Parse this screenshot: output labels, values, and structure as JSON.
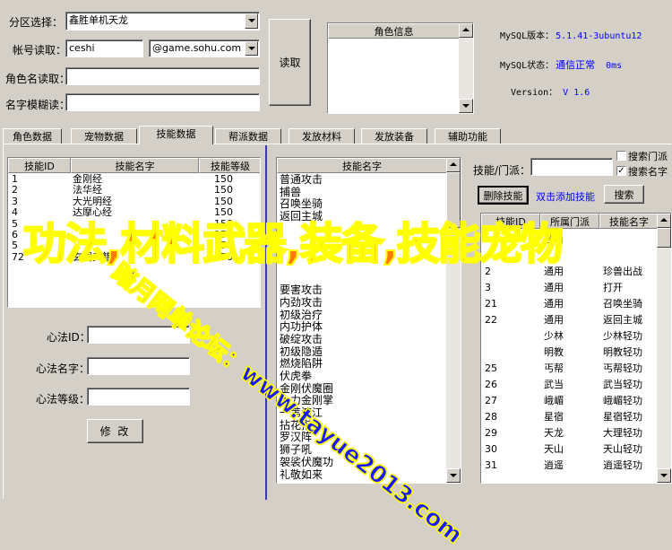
{
  "top": {
    "server_label": "分区选择：",
    "server_value": "鑫胜单机天龙",
    "account_label": "帐号读取：",
    "account_value": "ceshi",
    "domain_value": "@game.sohu.com",
    "role_read_label": "角色名读取：",
    "name_fuzzy_label": "名字模糊读：",
    "read_button": "读取",
    "role_info_header": "角色信息"
  },
  "mysql": {
    "version_label": "MySQL版本：",
    "version_value": "5.1.41-3ubuntu12",
    "status_label": "MySQL状态：",
    "status_value": "通信正常",
    "latency": "0ms",
    "app_version_label": "Version：",
    "app_version_value": "V 1.6"
  },
  "tabs": [
    "角色数据",
    "宠物数据",
    "技能数据",
    "帮派数据",
    "发放材料",
    "发放装备",
    "辅助功能"
  ],
  "active_tab": "技能数据",
  "skills_table": {
    "headers": [
      "技能ID",
      "技能名字",
      "技能等级"
    ],
    "rows": [
      {
        "id": "1",
        "name": "金刚经",
        "level": "150"
      },
      {
        "id": "2",
        "name": "法华经",
        "level": "150"
      },
      {
        "id": "3",
        "name": "大光明经",
        "level": "150"
      },
      {
        "id": "4",
        "name": "达摩心经",
        "level": "150"
      },
      {
        "id": "5",
        "name": "",
        "level": "150"
      },
      {
        "id": "6",
        "name": "",
        "level": "150"
      },
      {
        "id": "5",
        "name": "",
        "level": "150"
      },
      {
        "id": "72",
        "name": "玄同典籍",
        "level": "150"
      }
    ]
  },
  "xinfa": {
    "id_label": "心法ID：",
    "name_label": "心法名字：",
    "level_label": "心法等级：",
    "modify_button": "修 改"
  },
  "skill_names": {
    "header": "技能名字",
    "items": [
      "普通攻击",
      "捕兽",
      "召唤坐骑",
      "返回主城",
      "",
      "",
      "",
      "",
      "",
      "要害攻击",
      "内劲攻击",
      "初级治疗",
      "内功护体",
      "破绽攻击",
      "初级隐遁",
      "燃烧陷阱",
      "伏虎拳",
      "金刚伏魔圈",
      "大力金刚掌",
      "一苇渡江",
      "拈花指",
      "罗汉阵",
      "狮子吼",
      "袈裟伏魔功",
      "礼敬如来"
    ]
  },
  "right_panel": {
    "search_label": "技能/门派：",
    "search_value": "",
    "chk_sect_label": "搜索门派",
    "chk_sect_checked": false,
    "chk_name_label": "搜索名字",
    "chk_name_checked": true,
    "delete_button": "删除技能",
    "add_hint": "双击添加技能",
    "search_button": "搜索",
    "headers": [
      "技能ID",
      "所属门派",
      "技能名字"
    ],
    "rows": [
      {
        "id": "",
        "sect": "通用",
        "name": ""
      },
      {
        "id": "",
        "sect": "",
        "name": ""
      },
      {
        "id": "2",
        "sect": "通用",
        "name": "珍兽出战"
      },
      {
        "id": "3",
        "sect": "通用",
        "name": "打开"
      },
      {
        "id": "21",
        "sect": "通用",
        "name": "召唤坐骑"
      },
      {
        "id": "22",
        "sect": "通用",
        "name": "返回主城"
      },
      {
        "id": "",
        "sect": "少林",
        "name": "少林轻功"
      },
      {
        "id": "",
        "sect": "明教",
        "name": "明教轻功"
      },
      {
        "id": "25",
        "sect": "丐帮",
        "name": "丐帮轻功"
      },
      {
        "id": "26",
        "sect": "武当",
        "name": "武当轻功"
      },
      {
        "id": "27",
        "sect": "峨嵋",
        "name": "峨嵋轻功"
      },
      {
        "id": "28",
        "sect": "星宿",
        "name": "星宿轻功"
      },
      {
        "id": "29",
        "sect": "天龙",
        "name": "大理轻功"
      },
      {
        "id": "30",
        "sect": "天山",
        "name": "天山轻功"
      },
      {
        "id": "31",
        "sect": "逍遥",
        "name": "逍遥轻功"
      }
    ]
  },
  "watermark": {
    "main": "功法,材料武器,装备,技能宠物",
    "diagonal": "踏月网单论坛：www.tayue2013.com"
  },
  "colors": {
    "window_bg": "#d4d0c8",
    "link_blue": "#0000ff",
    "watermark_orange": "#ff7a00",
    "watermark_yellow": "#ffff00"
  }
}
